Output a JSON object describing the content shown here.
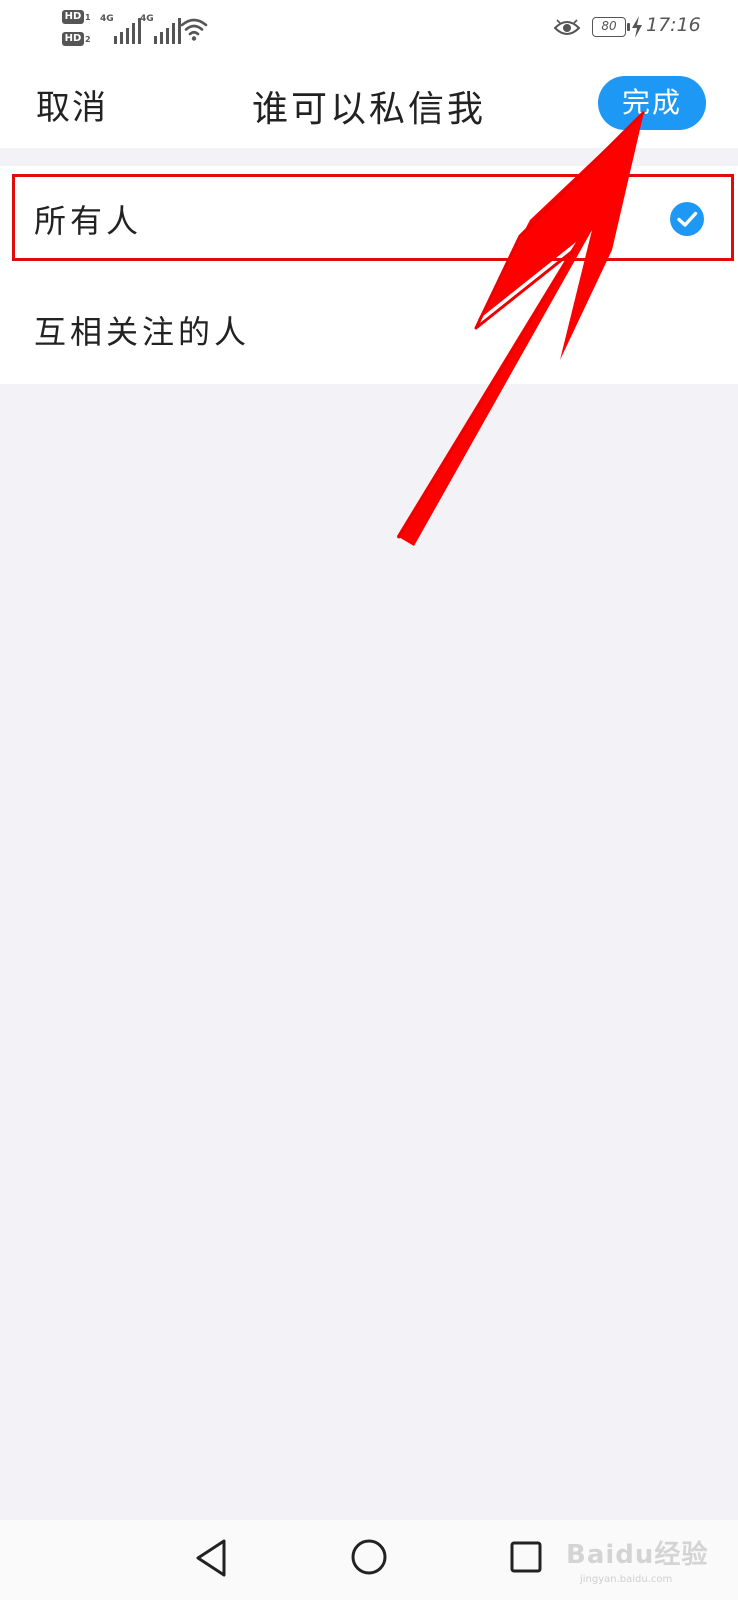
{
  "status_bar": {
    "hd1": "HD",
    "hd1_sub": "1",
    "hd2": "HD",
    "hd2_sub": "2",
    "net1": "4G",
    "net2": "4G",
    "battery": "80",
    "time": "17:16",
    "icons": [
      "signal-icon",
      "wifi-icon",
      "eye-icon",
      "battery-icon",
      "charging-icon"
    ]
  },
  "header": {
    "cancel_label": "取消",
    "title": "谁可以私信我",
    "done_label": "完成"
  },
  "options": [
    {
      "label": "所有人",
      "selected": true
    },
    {
      "label": "互相关注的人",
      "selected": false
    }
  ],
  "nav_bar": {
    "icons": [
      "back-icon",
      "home-icon",
      "recents-icon"
    ]
  },
  "watermark": {
    "text": "Baidu经验",
    "sub": "jingyan.baidu.com"
  },
  "colors": {
    "accent": "#1e98f5",
    "highlight": "#e00c0c",
    "background": "#f2f2f7"
  }
}
